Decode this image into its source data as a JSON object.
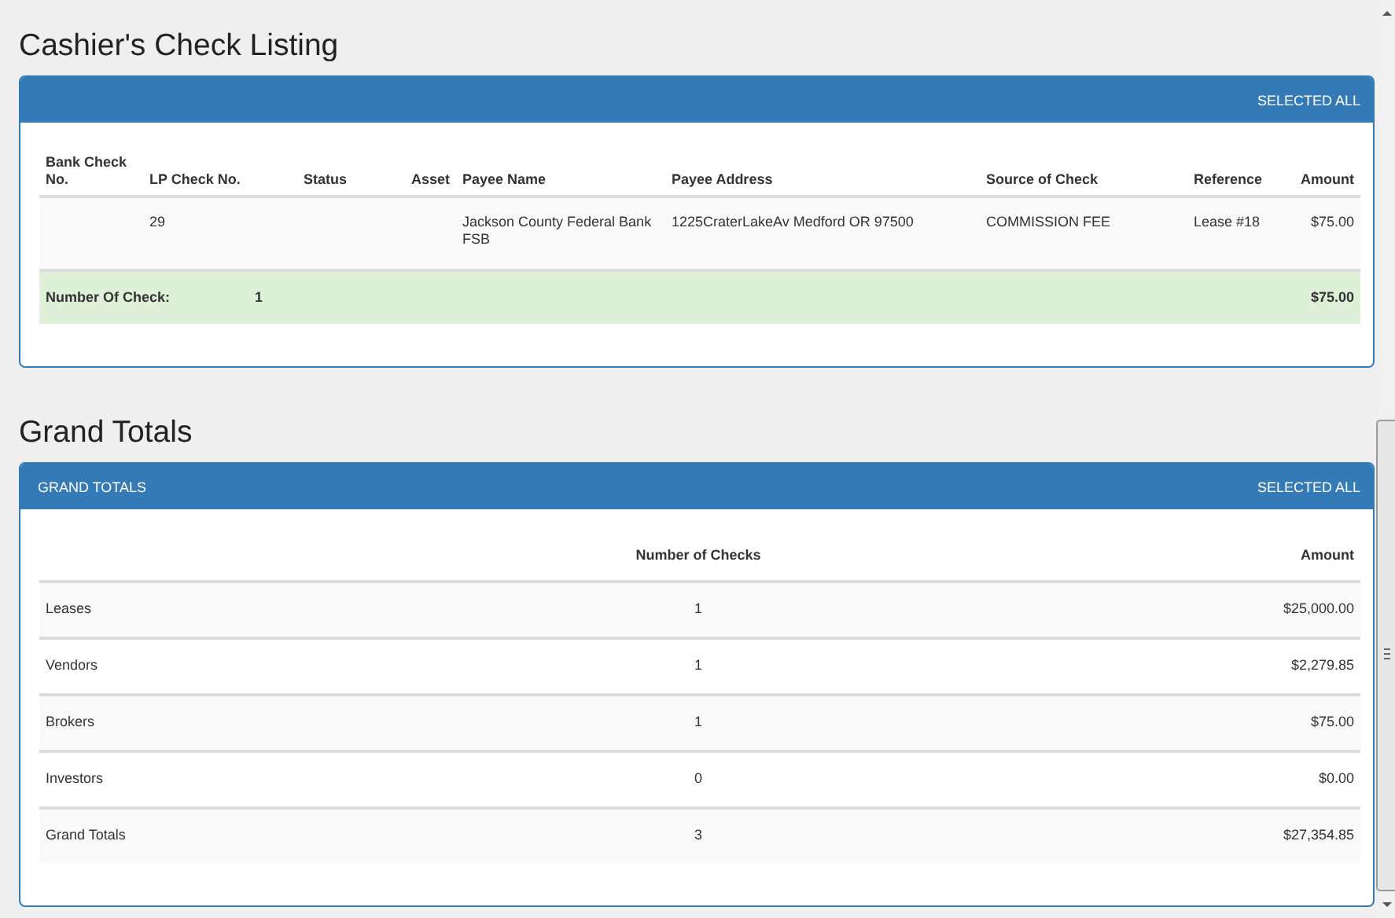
{
  "check_listing": {
    "title": "Cashier's Check Listing",
    "panel": {
      "heading_action": "SELECTED ALL",
      "columns": [
        "Bank Check No.",
        "LP Check No.",
        "Status",
        "Asset",
        "Payee Name",
        "Payee Address",
        "Source of Check",
        "Reference",
        "Amount"
      ],
      "rows": [
        {
          "cells": [
            null,
            "29",
            null,
            null,
            "Jackson County Federal Bank FSB",
            "1225CraterLakeAv Medford OR 97500",
            "COMMISSION FEE",
            "Lease #18",
            "$75.00"
          ]
        }
      ],
      "footer": {
        "label": "Number Of Check:",
        "count": "1",
        "amount": "$75.00"
      }
    }
  },
  "grand_totals": {
    "title": "Grand Totals",
    "panel": {
      "heading": "GRAND TOTALS",
      "heading_action": "SELECTED ALL",
      "columns": {
        "count": "Number of Checks",
        "amount": "Amount"
      },
      "rows": [
        {
          "label": "Leases",
          "count": "1",
          "amount": "$25,000.00"
        },
        {
          "label": "Vendors",
          "count": "1",
          "amount": "$2,279.85"
        },
        {
          "label": "Brokers",
          "count": "1",
          "amount": "$75.00"
        },
        {
          "label": "Investors",
          "count": "0",
          "amount": "$0.00"
        },
        {
          "label": "Grand Totals",
          "count": "3",
          "amount": "$27,354.85"
        }
      ]
    }
  }
}
